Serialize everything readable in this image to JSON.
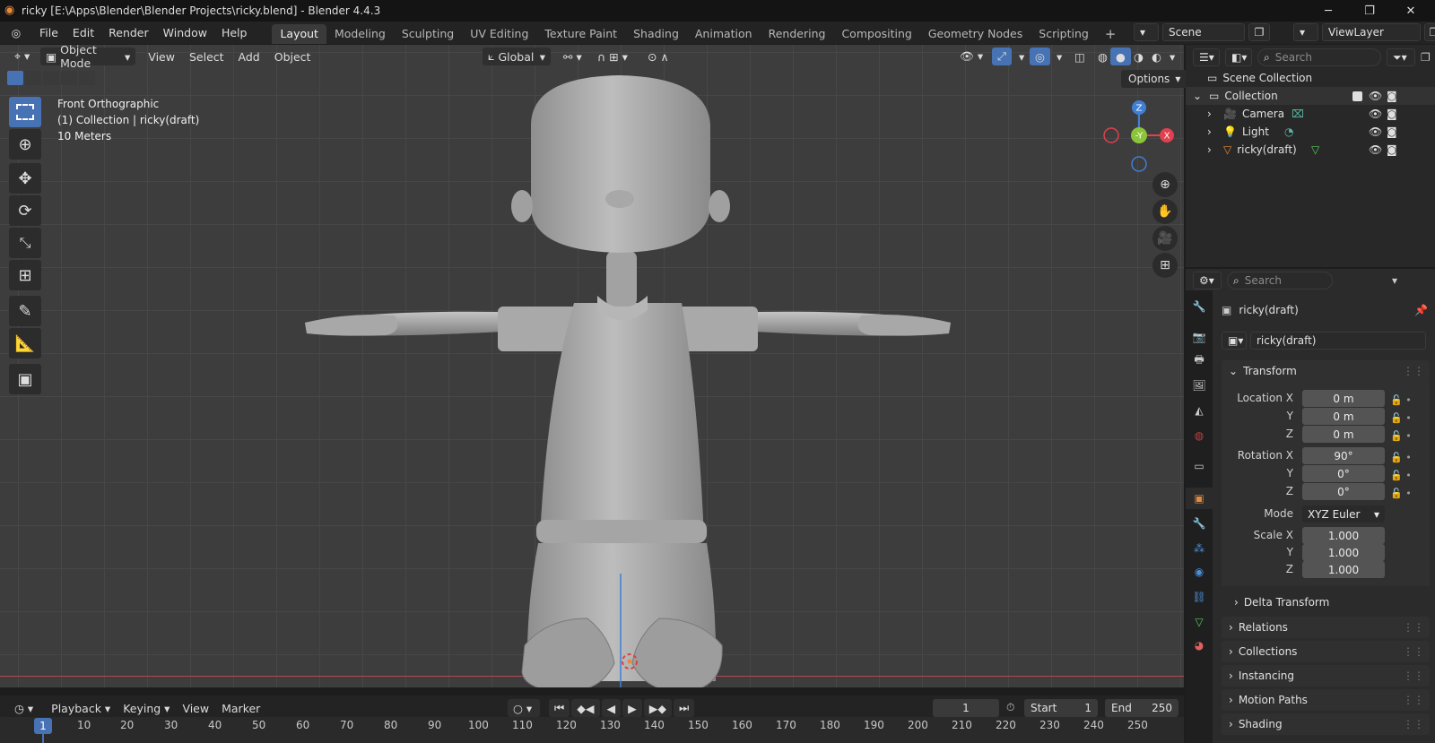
{
  "window": {
    "title": "ricky [E:\\Apps\\Blender\\Blender Projects\\ricky.blend] - Blender 4.4.3"
  },
  "menubar": {
    "items": [
      "File",
      "Edit",
      "Render",
      "Window",
      "Help"
    ]
  },
  "workspaces": [
    "Layout",
    "Modeling",
    "Sculpting",
    "UV Editing",
    "Texture Paint",
    "Shading",
    "Animation",
    "Rendering",
    "Compositing",
    "Geometry Nodes",
    "Scripting"
  ],
  "scene": {
    "name": "Scene",
    "view_layer": "ViewLayer"
  },
  "viewport_header": {
    "mode": "Object Mode",
    "menus": [
      "View",
      "Select",
      "Add",
      "Object"
    ],
    "orientation": "Global",
    "options_label": "Options"
  },
  "viewport_info": {
    "view": "Front Orthographic",
    "collection": "(1) Collection | ricky(draft)",
    "scale": "10 Meters"
  },
  "gizmo": {
    "z": "Z",
    "y": "-Y",
    "x": "X"
  },
  "outliner": {
    "search_placeholder": "Search",
    "root": "Scene Collection",
    "collection": "Collection",
    "objects": [
      "Camera",
      "Light",
      "ricky(draft)"
    ]
  },
  "properties": {
    "search_placeholder": "Search",
    "object_name": "ricky(draft)",
    "object_datablock": "ricky(draft)",
    "transform_title": "Transform",
    "location": {
      "label_x": "Location X",
      "x": "0 m",
      "y": "0 m",
      "z": "0 m"
    },
    "rotation": {
      "label_x": "Rotation X",
      "x": "90°",
      "y": "0°",
      "z": "0°"
    },
    "mode": {
      "label": "Mode",
      "value": "XYZ Euler"
    },
    "scale": {
      "label_x": "Scale X",
      "x": "1.000",
      "y": "1.000",
      "z": "1.000"
    },
    "axis_labels": {
      "y": "Y",
      "z": "Z"
    },
    "panels": [
      "Delta Transform",
      "Relations",
      "Collections",
      "Instancing",
      "Motion Paths",
      "Shading"
    ]
  },
  "timeline": {
    "menus": [
      "Playback",
      "Keying",
      "View",
      "Marker"
    ],
    "current_frame": "1",
    "start_label": "Start",
    "start": "1",
    "end_label": "End",
    "end": "250",
    "ticks": [
      "1",
      "10",
      "20",
      "30",
      "40",
      "50",
      "60",
      "70",
      "80",
      "90",
      "100",
      "110",
      "120",
      "130",
      "140",
      "150",
      "160",
      "170",
      "180",
      "190",
      "200",
      "210",
      "220",
      "230",
      "240",
      "250"
    ]
  },
  "colors": {
    "accent": "#4772b3",
    "x_axis": "#e0404f",
    "y_axis": "#8bc43a",
    "z_axis": "#3f7fd6",
    "object_orange": "#e58a3a"
  }
}
